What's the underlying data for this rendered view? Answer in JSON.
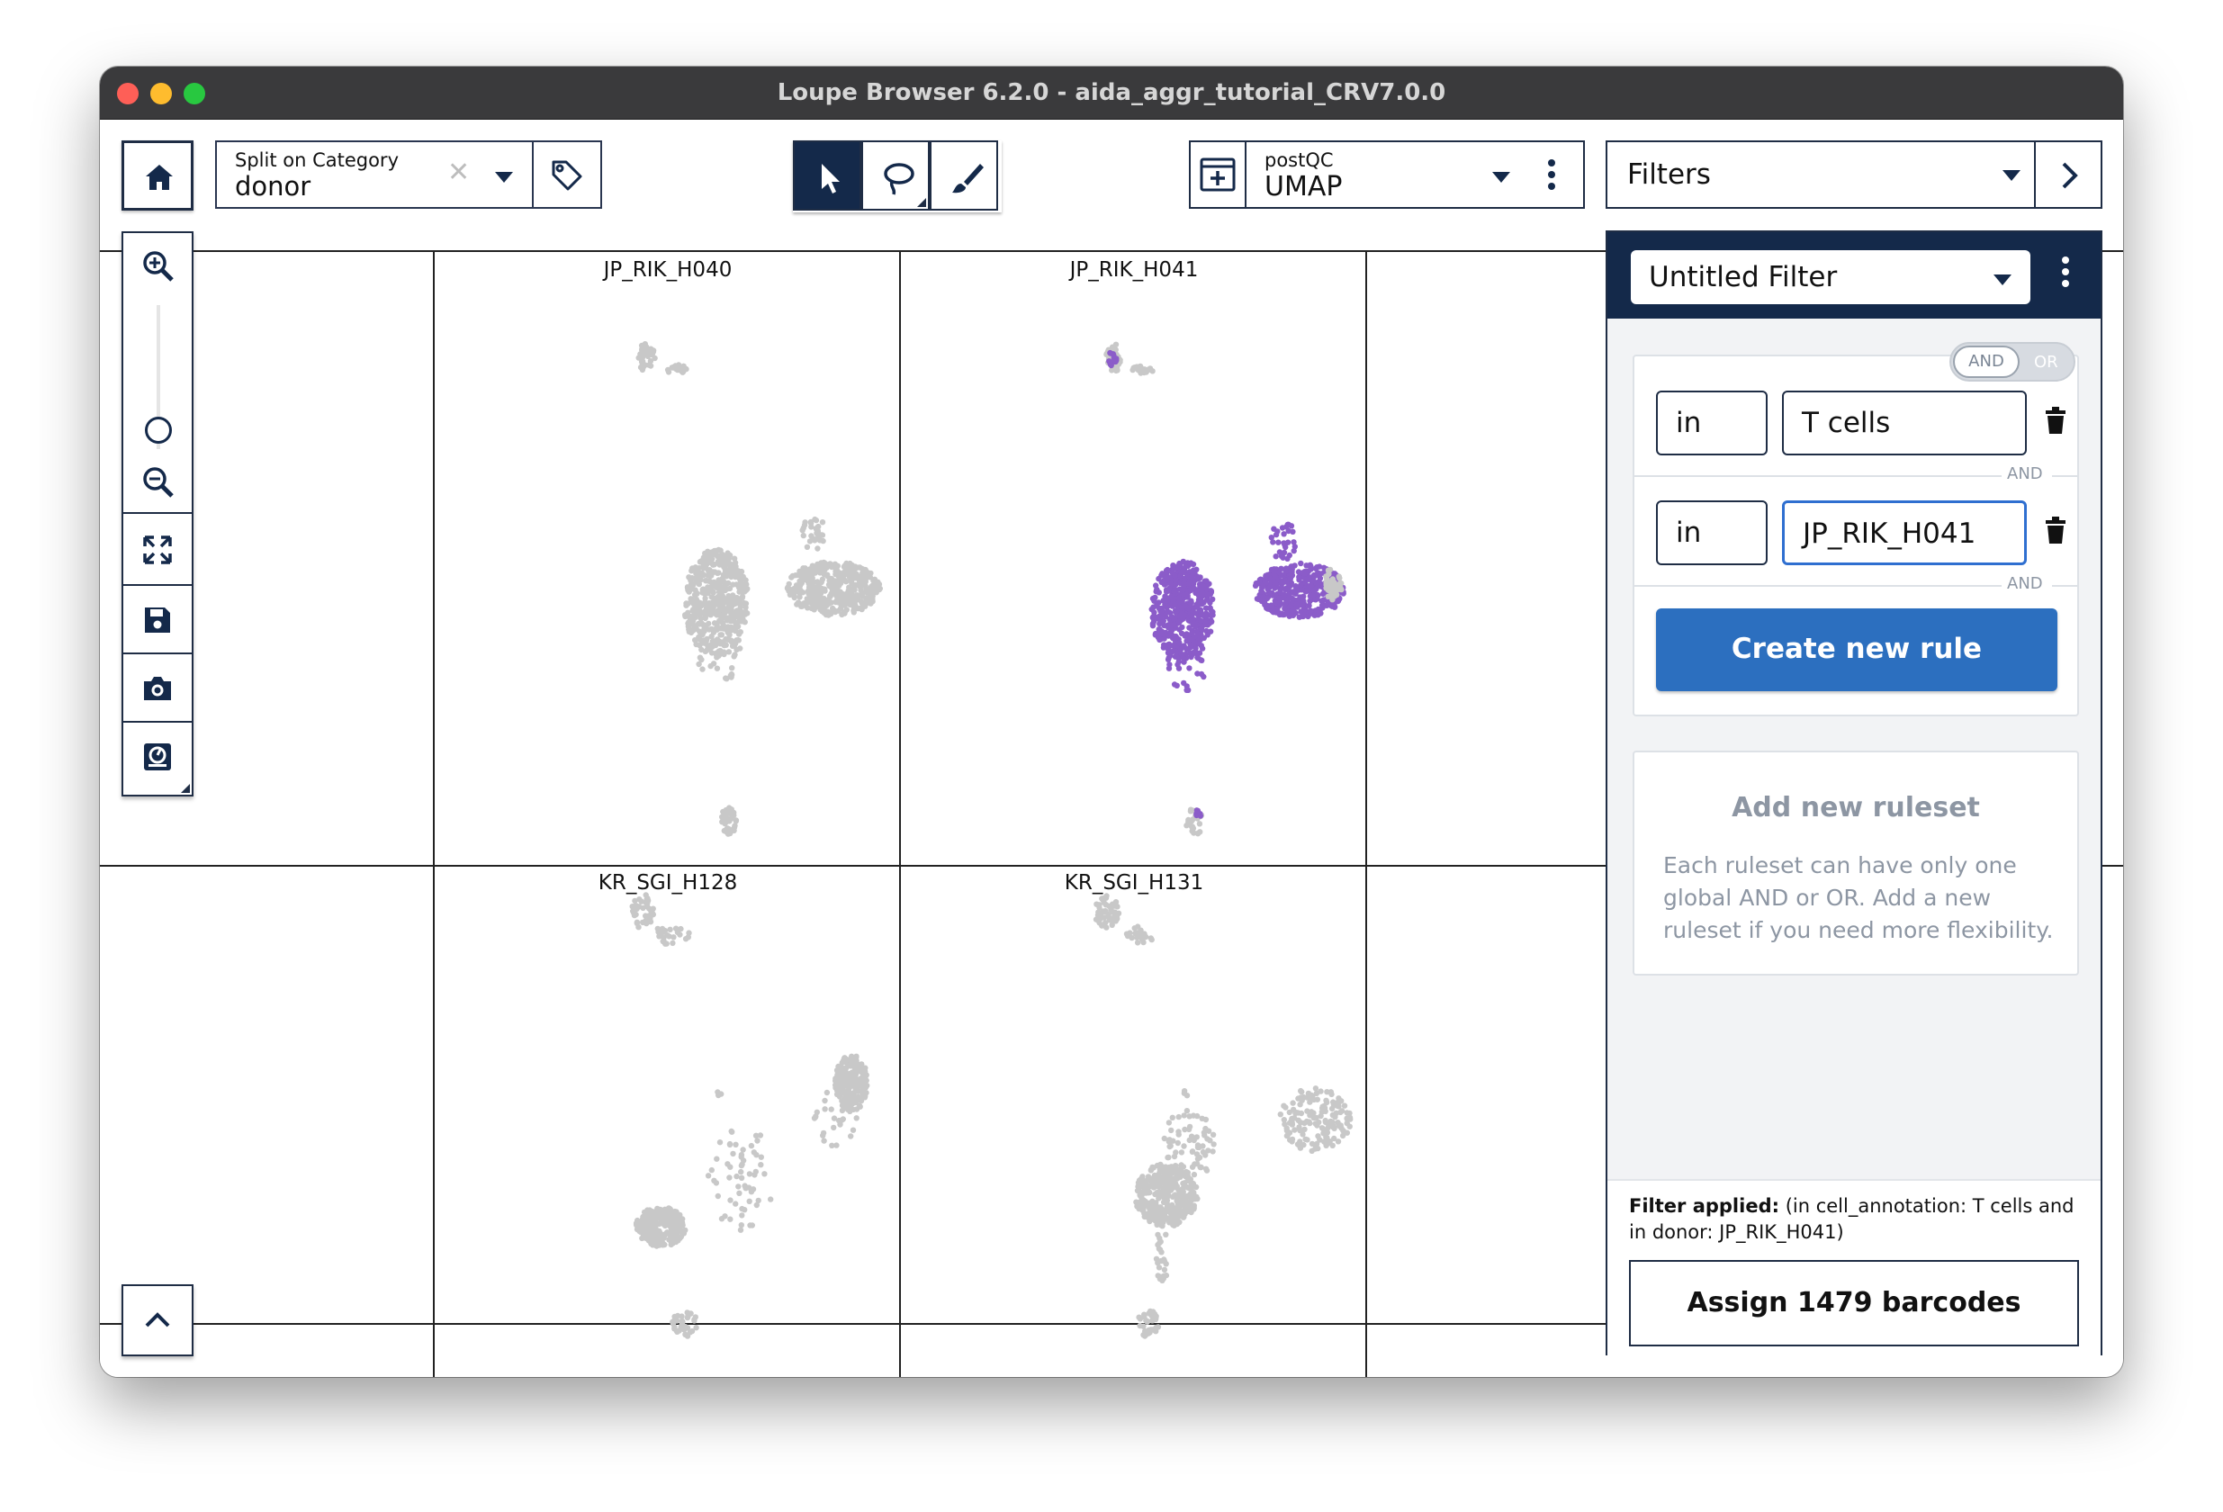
{
  "window": {
    "title": "Loupe Browser 6.2.0 - aida_aggr_tutorial_CRV7.0.0"
  },
  "toolbar": {
    "split": {
      "label": "Split on Category",
      "value": "donor",
      "clear": "✕"
    },
    "projection": {
      "label": "postQC",
      "value": "UMAP"
    },
    "filters_dropdown": "Filters"
  },
  "panels": [
    {
      "label": "JP_RIK_H040"
    },
    {
      "label": "JP_RIK_H041"
    },
    {
      "label": "KR_SGI_H128"
    },
    {
      "label": "KR_SGI_H131"
    }
  ],
  "colors": {
    "selected": "#8b5cc9",
    "unselected": "#c8c8c8",
    "navy": "#14294a",
    "primary": "#2c6fbf"
  },
  "filter_panel": {
    "name": "Untitled Filter",
    "toggle": {
      "and": "AND",
      "or": "OR",
      "active": "AND"
    },
    "rules": [
      {
        "operator": "in",
        "value": "T cells",
        "joiner": "AND"
      },
      {
        "operator": "in",
        "value": "JP_RIK_H041",
        "joiner": "AND"
      }
    ],
    "create_rule": "Create new rule",
    "add_ruleset": {
      "title": "Add new ruleset",
      "description": "Each ruleset can have only one global AND or OR. Add a new ruleset if you need more flexibility."
    },
    "applied_label": "Filter applied:",
    "applied_text": "(in cell_annotation: T cells and in donor: JP_RIK_H041)",
    "assign_button": "Assign 1479 barcodes"
  },
  "icons": [
    "home-icon",
    "tag-icon",
    "pointer-icon",
    "lasso-icon",
    "brush-icon",
    "add-projection-icon",
    "kebab-icon",
    "chevron-right-icon",
    "zoom-in-icon",
    "zoom-out-icon",
    "fit-view-icon",
    "save-icon",
    "camera-icon",
    "settings-icon",
    "chevron-up-icon",
    "trash-icon",
    "caret-down-icon"
  ]
}
